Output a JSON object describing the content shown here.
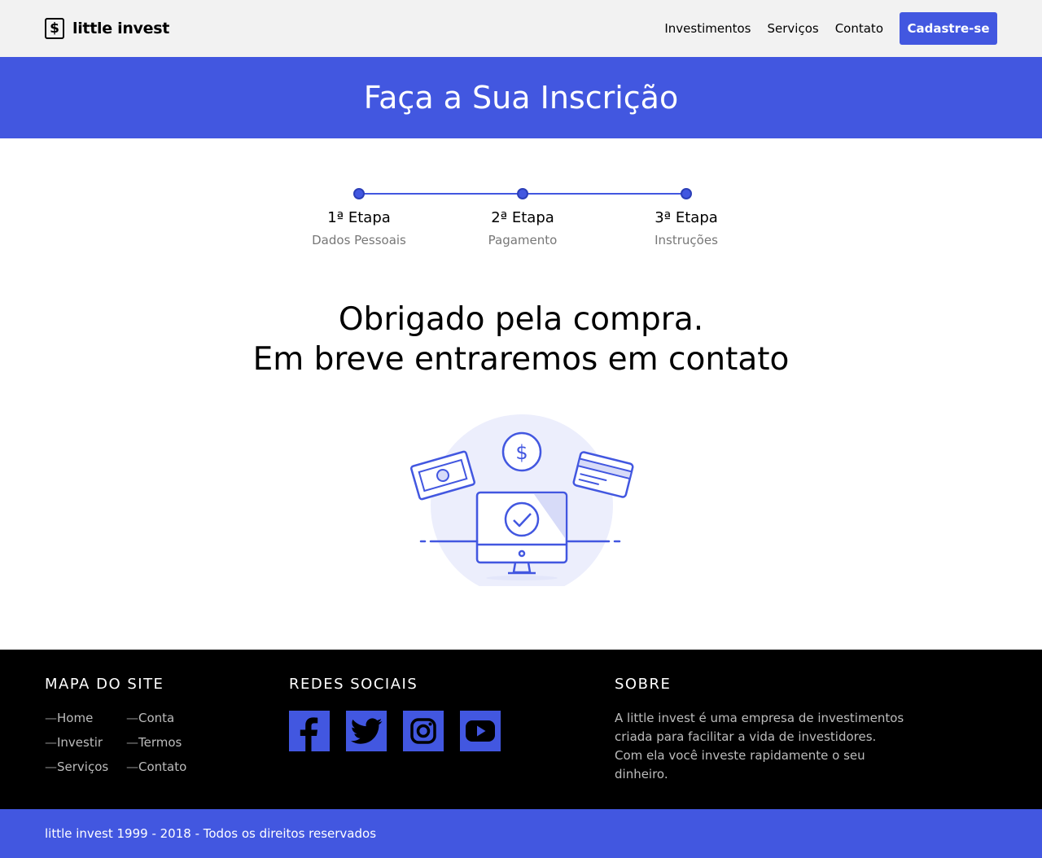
{
  "header": {
    "logo_text": "little invest",
    "logo_symbol": "$",
    "nav": [
      "Investimentos",
      "Serviços",
      "Contato"
    ],
    "cta_label": "Cadastre-se"
  },
  "hero": {
    "title": "Faça a Sua Inscrição"
  },
  "steps": [
    {
      "title": "1ª Etapa",
      "subtitle": "Dados Pessoais"
    },
    {
      "title": "2ª Etapa",
      "subtitle": "Pagamento"
    },
    {
      "title": "3ª Etapa",
      "subtitle": "Instruções"
    }
  ],
  "message": {
    "line1": "Obrigado pela compra.",
    "line2": "Em breve entraremos em contato"
  },
  "illustration": {
    "icons": [
      "banknote-icon",
      "dollar-coin-icon",
      "credit-card-icon",
      "computer-check-icon"
    ]
  },
  "footer": {
    "sitemap": {
      "heading": "MAPA DO SITE",
      "links": [
        "Home",
        "Conta",
        "Investir",
        "Termos",
        "Serviços",
        "Contato"
      ]
    },
    "social": {
      "heading": "REDES SOCIAIS",
      "icons": [
        "facebook-icon",
        "twitter-icon",
        "instagram-icon",
        "youtube-icon"
      ]
    },
    "about": {
      "heading": "SOBRE",
      "text": "A little invest é uma empresa de investimentos criada para facilitar a vida de investidores. Com ela você investe rapidamente o seu dinheiro."
    },
    "copyright": "little invest 1999 - 2018 - Todos os direitos reservados"
  },
  "colors": {
    "accent": "#4257e0",
    "header_bg": "#f2f2f2",
    "footer_bg": "#000000",
    "muted_text": "#777777"
  }
}
